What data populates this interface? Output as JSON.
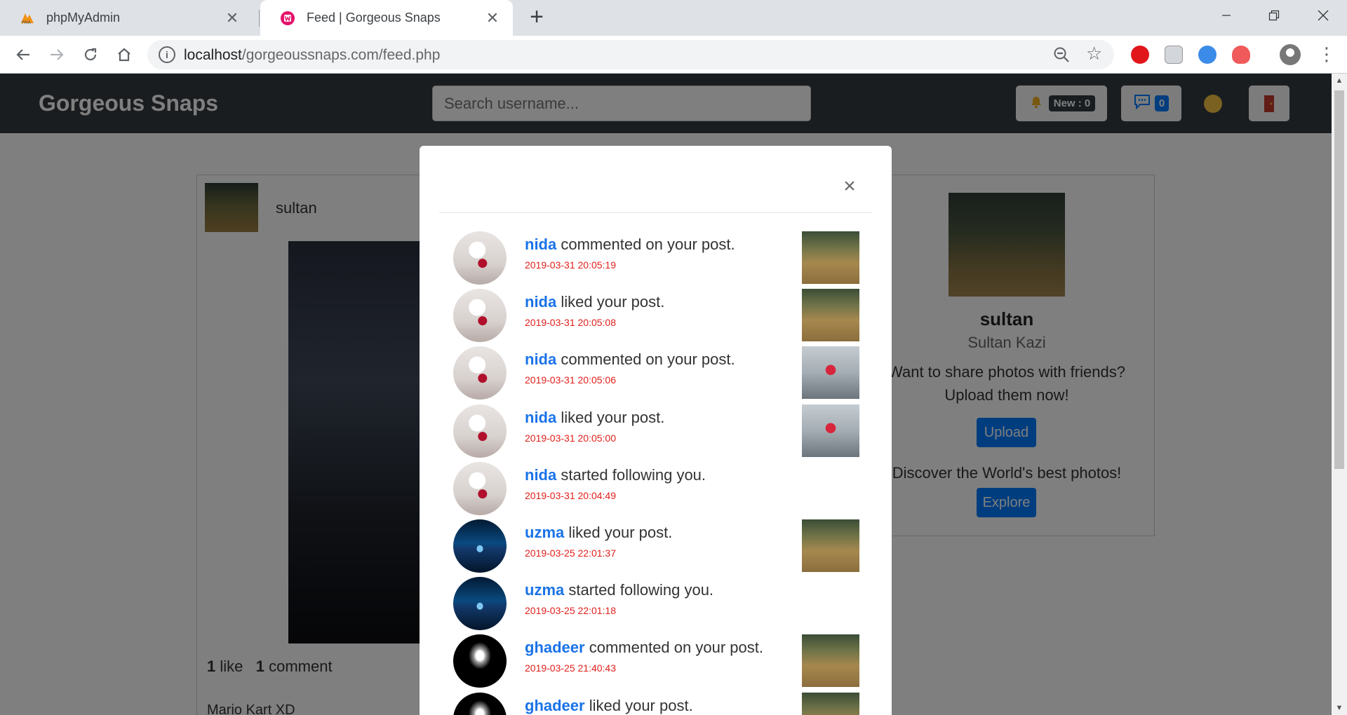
{
  "browser": {
    "tabs": [
      {
        "title": "phpMyAdmin",
        "icon": "phpmyadmin-icon"
      },
      {
        "title": "Feed | Gorgeous Snaps",
        "icon": "wamp-icon"
      }
    ],
    "url_host": "localhost",
    "url_path": "/gorgeoussnaps.com/feed.php"
  },
  "navbar": {
    "brand": "Gorgeous Snaps",
    "search_placeholder": "Search username...",
    "notif_label": "New : 0",
    "messages_count": "0"
  },
  "post": {
    "username": "sultan",
    "likes_count": "1",
    "likes_label": "like",
    "comments_count": "1",
    "comments_label": "comment",
    "caption": "Mario Kart XD"
  },
  "profile": {
    "username": "sultan",
    "full_name": "Sultan Kazi",
    "share_text": "Want to share photos with friends? Upload them now!",
    "upload_label": "Upload",
    "discover_text": "Discover the World's best photos!",
    "explore_label": "Explore"
  },
  "modal": {
    "close_glyph": "×",
    "notifications": [
      {
        "user": "nida",
        "action": "commented on your post.",
        "time": "2019-03-31 20:05:19",
        "avatar": "nida",
        "thumb": "field"
      },
      {
        "user": "nida",
        "action": "liked your post.",
        "time": "2019-03-31 20:05:08",
        "avatar": "nida",
        "thumb": "field"
      },
      {
        "user": "nida",
        "action": "commented on your post.",
        "time": "2019-03-31 20:05:06",
        "avatar": "nida",
        "thumb": "car"
      },
      {
        "user": "nida",
        "action": "liked your post.",
        "time": "2019-03-31 20:05:00",
        "avatar": "nida",
        "thumb": "car"
      },
      {
        "user": "nida",
        "action": "started following you.",
        "time": "2019-03-31 20:04:49",
        "avatar": "nida",
        "thumb": ""
      },
      {
        "user": "uzma",
        "action": "liked your post.",
        "time": "2019-03-25 22:01:37",
        "avatar": "uzma",
        "thumb": "field"
      },
      {
        "user": "uzma",
        "action": "started following you.",
        "time": "2019-03-25 22:01:18",
        "avatar": "uzma",
        "thumb": ""
      },
      {
        "user": "ghadeer",
        "action": "commented on your post.",
        "time": "2019-03-25 21:40:43",
        "avatar": "ghadeer",
        "thumb": "field"
      },
      {
        "user": "ghadeer",
        "action": "liked your post.",
        "time": "",
        "avatar": "ghadeer",
        "thumb": "field"
      }
    ]
  },
  "colors": {
    "username_blue": "#1a73e8",
    "time_red": "#e0201c",
    "navbar_dark": "#343a40",
    "button_blue": "#007bff"
  }
}
